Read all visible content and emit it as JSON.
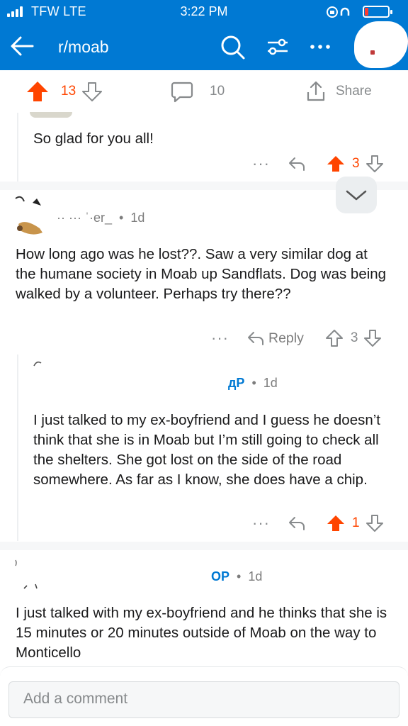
{
  "status_bar": {
    "carrier": "TFW  LTE",
    "time": "3:22 PM"
  },
  "header": {
    "subreddit": "r/moab"
  },
  "post_actions": {
    "upvotes": "13",
    "comments": "10",
    "share": "Share"
  },
  "comments": [
    {
      "body": "So glad for you all!",
      "score": "3",
      "vote": "up"
    },
    {
      "username": "·· ··· ˈ·er_",
      "separator": "•",
      "age": "1d",
      "body": "How long ago was he lost??. Saw a very similar dog at the humane society in Moab up Sandflats. Dog was being walked by a volunteer. Perhaps try there??",
      "reply_label": "Reply",
      "score": "3",
      "vote": "none"
    },
    {
      "username": "дP",
      "separator": "•",
      "age": "1d",
      "body": "I just talked to my ex-boyfriend and I guess he doesn’t think that she is in Moab but I’m still going to check all the shelters. She got lost on the side of the road somewhere. As far as I know, she does have a chip.",
      "score": "1",
      "vote": "up"
    },
    {
      "username": "OP",
      "separator": "•",
      "age": "1d",
      "body": "I just talked with my ex-boyfriend and he thinks that she is 15 minutes or 20 minutes outside of Moab on the way to Monticello"
    }
  ],
  "composer": {
    "placeholder": "Add a comment"
  },
  "colors": {
    "header_blue": "#0079d3",
    "upvote_orange": "#ff4500",
    "gray": "#878a8c"
  }
}
